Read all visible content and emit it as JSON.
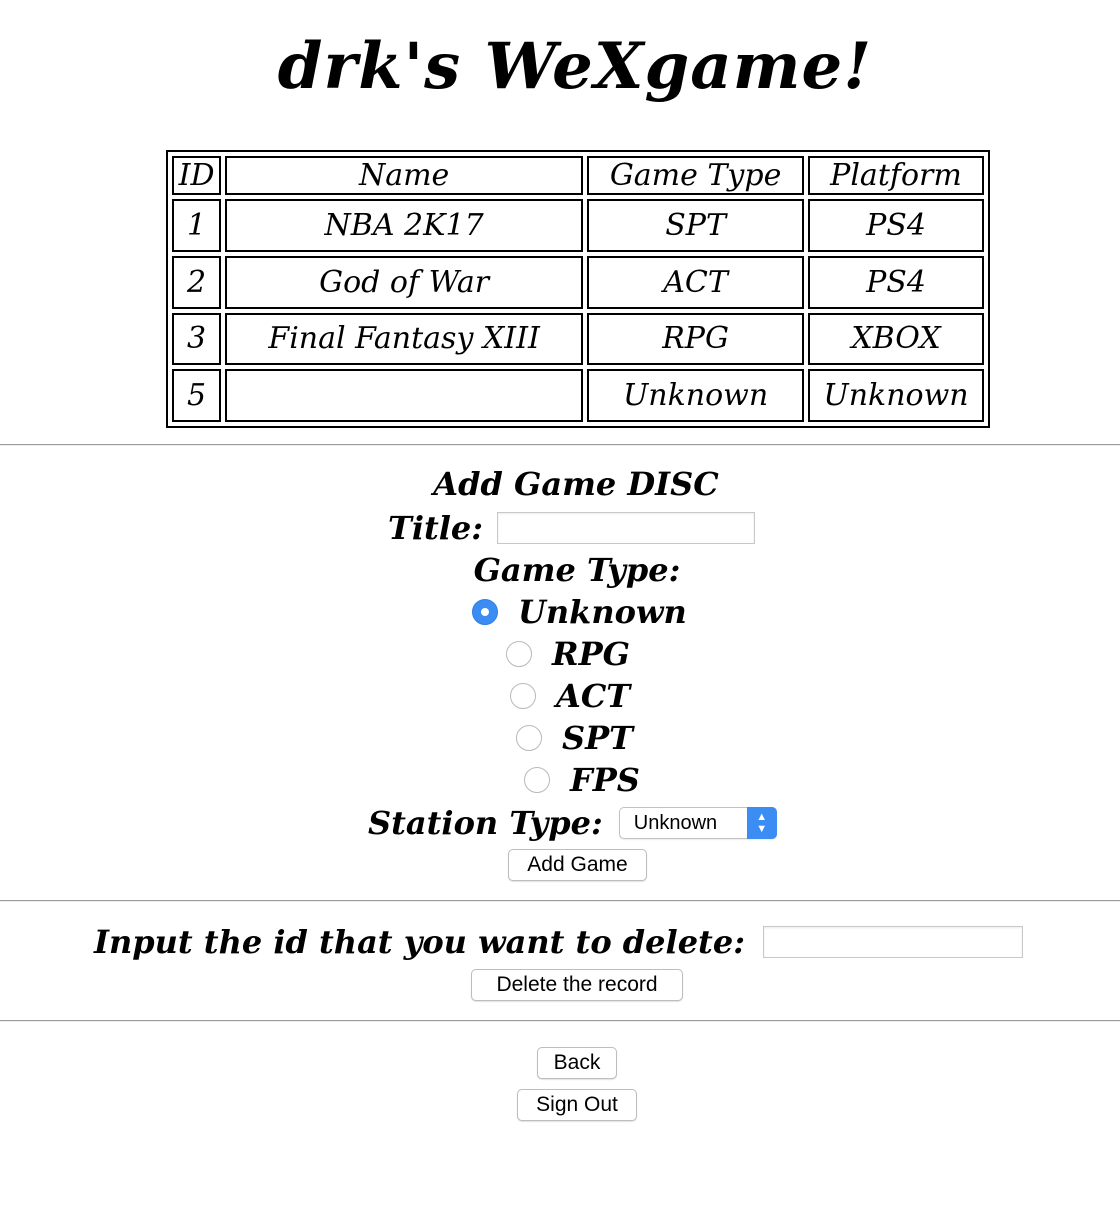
{
  "page": {
    "title": "drk's WeXgame!"
  },
  "table": {
    "headers": {
      "id": "ID",
      "name": "Name",
      "game_type": "Game Type",
      "platform": "Platform"
    },
    "rows": [
      {
        "id": "1",
        "name": "NBA 2K17",
        "game_type": "SPT",
        "platform": "PS4"
      },
      {
        "id": "2",
        "name": "God of War",
        "game_type": "ACT",
        "platform": "PS4"
      },
      {
        "id": "3",
        "name": "Final Fantasy XIII",
        "game_type": "RPG",
        "platform": "XBOX"
      },
      {
        "id": "5",
        "name": "",
        "game_type": "Unknown",
        "platform": "Unknown"
      }
    ]
  },
  "add_form": {
    "heading": "Add Game DISC",
    "title_label": "Title:",
    "title_value": "",
    "game_type_label": "Game Type:",
    "game_type_options": [
      {
        "label": "Unknown",
        "checked": true
      },
      {
        "label": "RPG",
        "checked": false
      },
      {
        "label": "ACT",
        "checked": false
      },
      {
        "label": "SPT",
        "checked": false
      },
      {
        "label": "FPS",
        "checked": false
      }
    ],
    "station_type_label": "Station Type:",
    "station_type_selected": "Unknown",
    "submit_label": "Add Game"
  },
  "delete_form": {
    "label": "Input the id that you want to delete:",
    "id_value": "",
    "submit_label": "Delete the record"
  },
  "footer": {
    "back_label": "Back",
    "signout_label": "Sign Out"
  },
  "colors": {
    "accent": "#3b8df3",
    "divider": "#9a9a9a"
  }
}
